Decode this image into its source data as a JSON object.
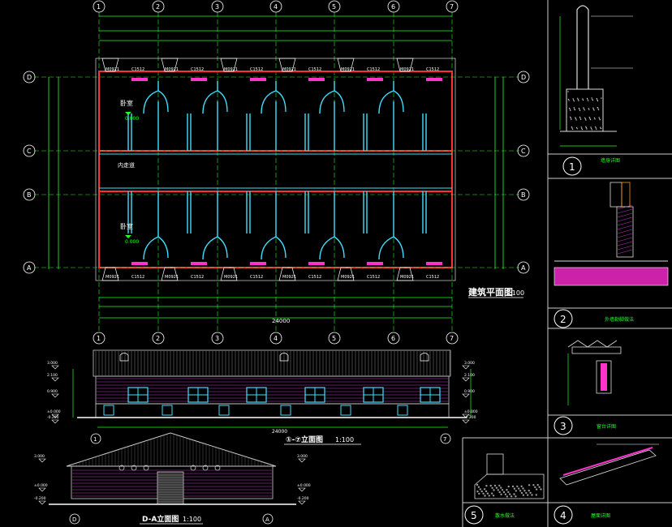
{
  "plan": {
    "title": "建筑平面图",
    "scale": "1:100",
    "grid_numbers": [
      "1",
      "2",
      "3",
      "4",
      "5",
      "6",
      "7"
    ],
    "grid_letters": [
      "D",
      "C",
      "B",
      "A"
    ],
    "room_upper": "卧室",
    "room_lower": "卧室",
    "corridor": "内走道",
    "window_tag": "C1512",
    "door_tag": "M0921",
    "total_width": "24000",
    "level_upper": "0.000",
    "level_lower": "0.000"
  },
  "front_elevation": {
    "title": "①-⑦立面图",
    "scale": "1:100",
    "levels": [
      "3.000",
      "2.100",
      "0.900",
      "±0.000",
      "-0.200"
    ],
    "width": "24000"
  },
  "side_elevation": {
    "title": "D-A立面图",
    "scale": "1:100",
    "levels": [
      "3.000",
      "±0.000",
      "-0.200"
    ],
    "grid_left": "D",
    "grid_right": "A"
  },
  "details": [
    {
      "num": "1",
      "note": "墙身详图"
    },
    {
      "num": "2",
      "note": "外墙勒脚做法"
    },
    {
      "num": "3",
      "note": "窗台详图"
    },
    {
      "num": "4",
      "note": "屋面详图"
    },
    {
      "num": "5",
      "note": "散水做法"
    }
  ],
  "colors": {
    "background": "#000000",
    "wall": "#ff3030",
    "partition": "#40e0ff",
    "dimension": "#33ff33",
    "window_fill": "#ff33cc",
    "text": "#ffffff",
    "hatch": "#ff33ff"
  }
}
